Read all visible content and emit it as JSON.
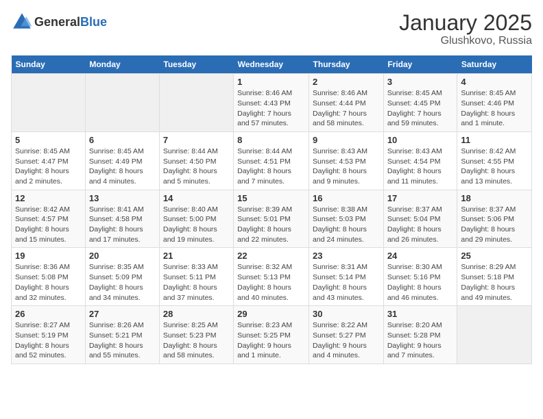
{
  "logo": {
    "general": "General",
    "blue": "Blue"
  },
  "title": "January 2025",
  "subtitle": "Glushkovo, Russia",
  "days_of_week": [
    "Sunday",
    "Monday",
    "Tuesday",
    "Wednesday",
    "Thursday",
    "Friday",
    "Saturday"
  ],
  "weeks": [
    [
      {
        "day": "",
        "info": ""
      },
      {
        "day": "",
        "info": ""
      },
      {
        "day": "",
        "info": ""
      },
      {
        "day": "1",
        "info": "Sunrise: 8:46 AM\nSunset: 4:43 PM\nDaylight: 7 hours and 57 minutes."
      },
      {
        "day": "2",
        "info": "Sunrise: 8:46 AM\nSunset: 4:44 PM\nDaylight: 7 hours and 58 minutes."
      },
      {
        "day": "3",
        "info": "Sunrise: 8:45 AM\nSunset: 4:45 PM\nDaylight: 7 hours and 59 minutes."
      },
      {
        "day": "4",
        "info": "Sunrise: 8:45 AM\nSunset: 4:46 PM\nDaylight: 8 hours and 1 minute."
      }
    ],
    [
      {
        "day": "5",
        "info": "Sunrise: 8:45 AM\nSunset: 4:47 PM\nDaylight: 8 hours and 2 minutes."
      },
      {
        "day": "6",
        "info": "Sunrise: 8:45 AM\nSunset: 4:49 PM\nDaylight: 8 hours and 4 minutes."
      },
      {
        "day": "7",
        "info": "Sunrise: 8:44 AM\nSunset: 4:50 PM\nDaylight: 8 hours and 5 minutes."
      },
      {
        "day": "8",
        "info": "Sunrise: 8:44 AM\nSunset: 4:51 PM\nDaylight: 8 hours and 7 minutes."
      },
      {
        "day": "9",
        "info": "Sunrise: 8:43 AM\nSunset: 4:53 PM\nDaylight: 8 hours and 9 minutes."
      },
      {
        "day": "10",
        "info": "Sunrise: 8:43 AM\nSunset: 4:54 PM\nDaylight: 8 hours and 11 minutes."
      },
      {
        "day": "11",
        "info": "Sunrise: 8:42 AM\nSunset: 4:55 PM\nDaylight: 8 hours and 13 minutes."
      }
    ],
    [
      {
        "day": "12",
        "info": "Sunrise: 8:42 AM\nSunset: 4:57 PM\nDaylight: 8 hours and 15 minutes."
      },
      {
        "day": "13",
        "info": "Sunrise: 8:41 AM\nSunset: 4:58 PM\nDaylight: 8 hours and 17 minutes."
      },
      {
        "day": "14",
        "info": "Sunrise: 8:40 AM\nSunset: 5:00 PM\nDaylight: 8 hours and 19 minutes."
      },
      {
        "day": "15",
        "info": "Sunrise: 8:39 AM\nSunset: 5:01 PM\nDaylight: 8 hours and 22 minutes."
      },
      {
        "day": "16",
        "info": "Sunrise: 8:38 AM\nSunset: 5:03 PM\nDaylight: 8 hours and 24 minutes."
      },
      {
        "day": "17",
        "info": "Sunrise: 8:37 AM\nSunset: 5:04 PM\nDaylight: 8 hours and 26 minutes."
      },
      {
        "day": "18",
        "info": "Sunrise: 8:37 AM\nSunset: 5:06 PM\nDaylight: 8 hours and 29 minutes."
      }
    ],
    [
      {
        "day": "19",
        "info": "Sunrise: 8:36 AM\nSunset: 5:08 PM\nDaylight: 8 hours and 32 minutes."
      },
      {
        "day": "20",
        "info": "Sunrise: 8:35 AM\nSunset: 5:09 PM\nDaylight: 8 hours and 34 minutes."
      },
      {
        "day": "21",
        "info": "Sunrise: 8:33 AM\nSunset: 5:11 PM\nDaylight: 8 hours and 37 minutes."
      },
      {
        "day": "22",
        "info": "Sunrise: 8:32 AM\nSunset: 5:13 PM\nDaylight: 8 hours and 40 minutes."
      },
      {
        "day": "23",
        "info": "Sunrise: 8:31 AM\nSunset: 5:14 PM\nDaylight: 8 hours and 43 minutes."
      },
      {
        "day": "24",
        "info": "Sunrise: 8:30 AM\nSunset: 5:16 PM\nDaylight: 8 hours and 46 minutes."
      },
      {
        "day": "25",
        "info": "Sunrise: 8:29 AM\nSunset: 5:18 PM\nDaylight: 8 hours and 49 minutes."
      }
    ],
    [
      {
        "day": "26",
        "info": "Sunrise: 8:27 AM\nSunset: 5:19 PM\nDaylight: 8 hours and 52 minutes."
      },
      {
        "day": "27",
        "info": "Sunrise: 8:26 AM\nSunset: 5:21 PM\nDaylight: 8 hours and 55 minutes."
      },
      {
        "day": "28",
        "info": "Sunrise: 8:25 AM\nSunset: 5:23 PM\nDaylight: 8 hours and 58 minutes."
      },
      {
        "day": "29",
        "info": "Sunrise: 8:23 AM\nSunset: 5:25 PM\nDaylight: 9 hours and 1 minute."
      },
      {
        "day": "30",
        "info": "Sunrise: 8:22 AM\nSunset: 5:27 PM\nDaylight: 9 hours and 4 minutes."
      },
      {
        "day": "31",
        "info": "Sunrise: 8:20 AM\nSunset: 5:28 PM\nDaylight: 9 hours and 7 minutes."
      },
      {
        "day": "",
        "info": ""
      }
    ]
  ]
}
